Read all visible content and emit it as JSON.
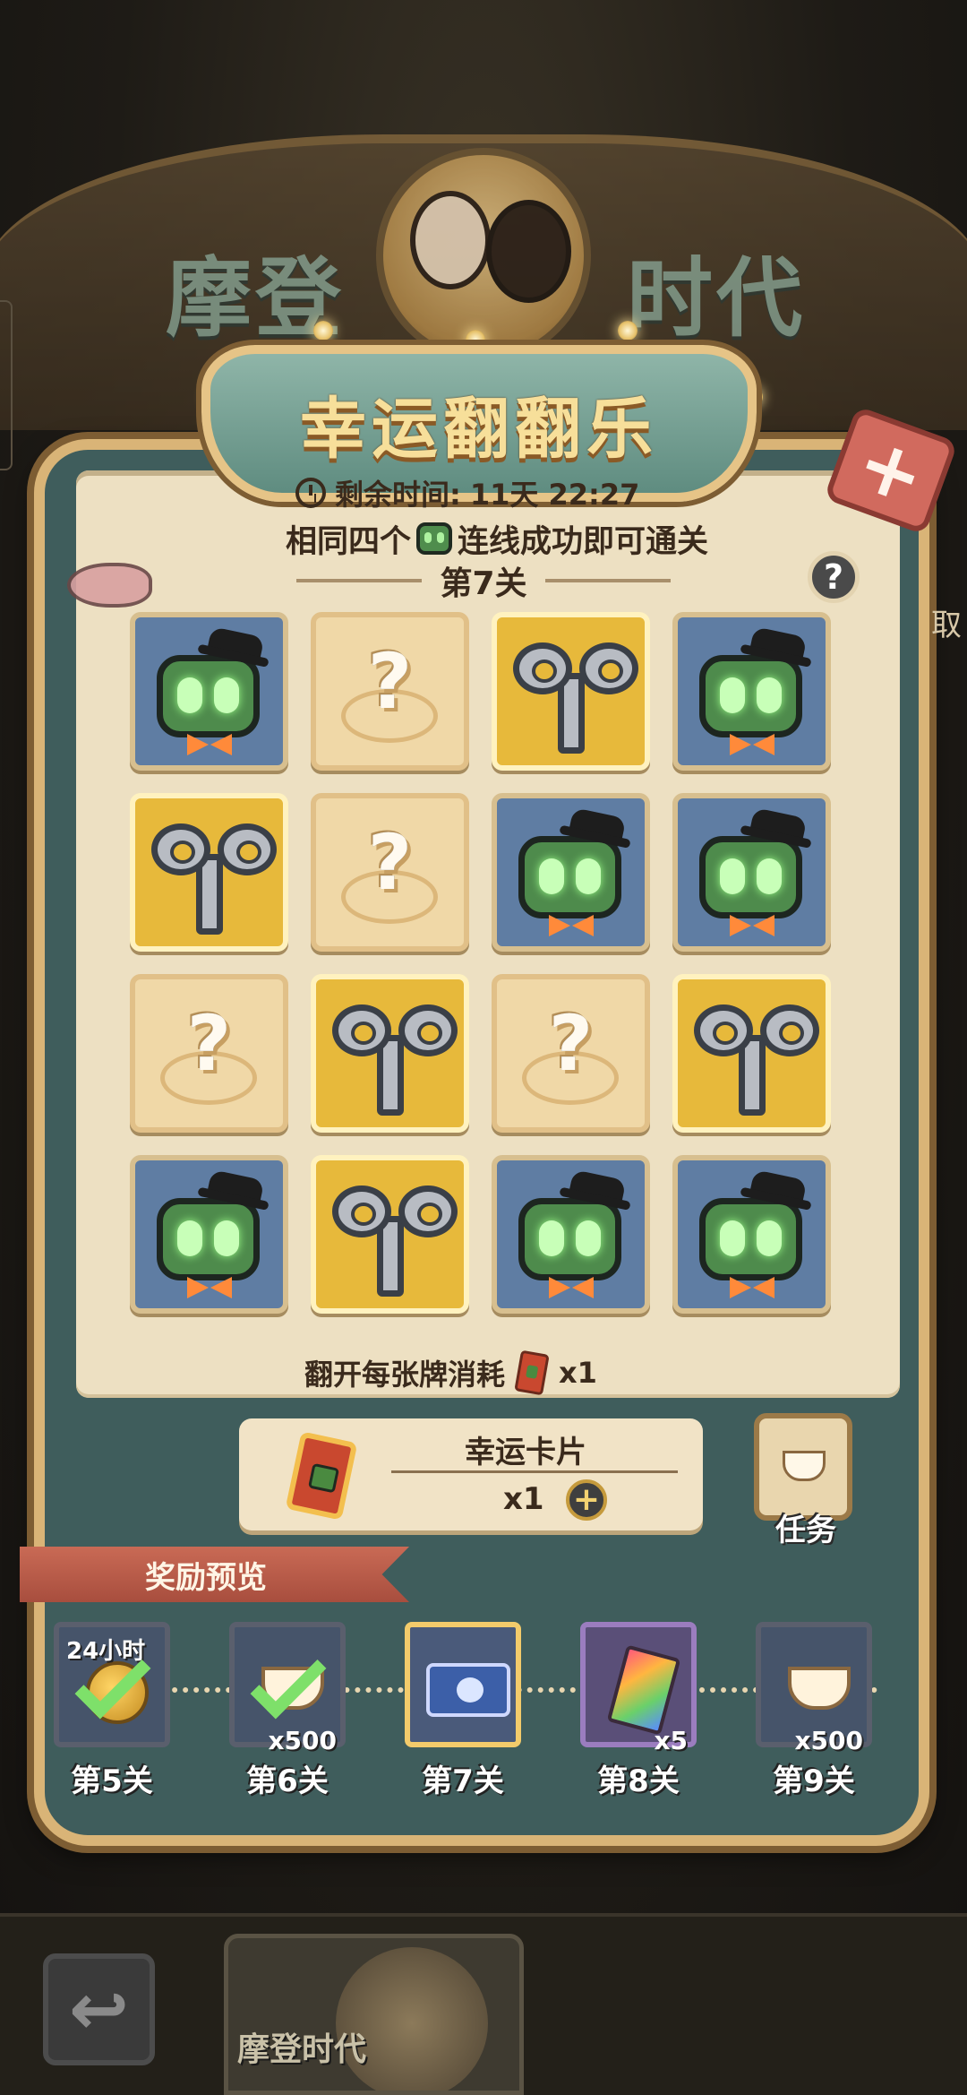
{
  "background": {
    "marquee_left": "摩登",
    "marquee_right": "时代"
  },
  "header": {
    "title": "幸运翻翻乐",
    "close_icon": "close-icon"
  },
  "timer": {
    "label": "剩余时间:",
    "value": "11天 22:27"
  },
  "rules": {
    "prefix": "相同四个",
    "suffix": "连线成功即可通关"
  },
  "level": {
    "current": "第7关"
  },
  "help": {
    "label": "?"
  },
  "side_tab": {
    "text": "取"
  },
  "board": {
    "cards": [
      [
        "robot",
        "hidden",
        "key",
        "robot"
      ],
      [
        "key",
        "hidden",
        "robot",
        "robot"
      ],
      [
        "hidden",
        "key",
        "hidden",
        "key"
      ],
      [
        "robot",
        "key",
        "robot",
        "robot"
      ]
    ],
    "hidden_symbol": "?"
  },
  "cost": {
    "label": "翻开每张牌消耗",
    "amount": "x1"
  },
  "lucky_card": {
    "name": "幸运卡片",
    "count": "x1",
    "add_label": "+"
  },
  "task": {
    "label": "任务"
  },
  "rewards": {
    "title": "奖励预览",
    "items": [
      {
        "level": "第5关",
        "badge": "24小时",
        "qty": "",
        "claimed": true,
        "icon": "coin-icon"
      },
      {
        "level": "第6关",
        "badge": "",
        "qty": "x500",
        "claimed": true,
        "icon": "coffee-cup-icon"
      },
      {
        "level": "第7关",
        "badge": "",
        "qty": "",
        "claimed": false,
        "icon": "ticket-icon"
      },
      {
        "level": "第8关",
        "badge": "",
        "qty": "x5",
        "claimed": false,
        "icon": "card-pack-icon"
      },
      {
        "level": "第9关",
        "badge": "",
        "qty": "x500",
        "claimed": false,
        "icon": "coffee-cup-icon"
      }
    ]
  },
  "bottom_nav": {
    "back_symbol": "↩",
    "tab_label": "摩登时代"
  },
  "colors": {
    "panel": "#3f5d5c",
    "frame": "#d9b477",
    "paper": "#ede0c2",
    "robot_card": "#5f7da3",
    "key_card": "#e7b93b",
    "hidden_card": "#f0d8a7",
    "title_text": "#f7df9a"
  }
}
